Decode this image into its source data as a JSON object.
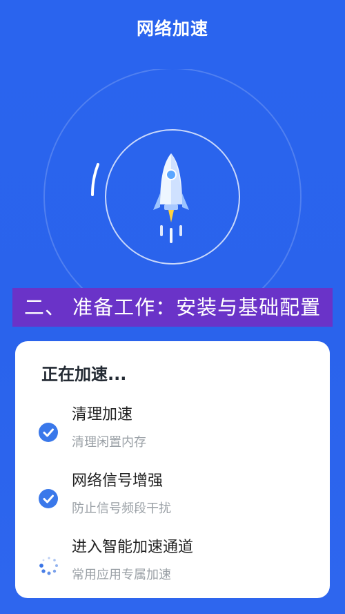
{
  "header": {
    "title": "网络加速"
  },
  "banner": {
    "text": "二、 准备工作：安装与基础配置"
  },
  "card": {
    "title": "正在加速...",
    "items": [
      {
        "label": "清理加速",
        "sub": "清理闲置内存",
        "status": "done",
        "icon": "check-circle-icon"
      },
      {
        "label": "网络信号增强",
        "sub": "防止信号频段干扰",
        "status": "done",
        "icon": "check-circle-icon"
      },
      {
        "label": "进入智能加速通道",
        "sub": "常用应用专属加速",
        "status": "loading",
        "icon": "spinner-icon"
      }
    ]
  },
  "colors": {
    "background": "#2a64ee",
    "banner": "#6a33c8",
    "check": "#3a78ea",
    "card": "#ffffff"
  }
}
